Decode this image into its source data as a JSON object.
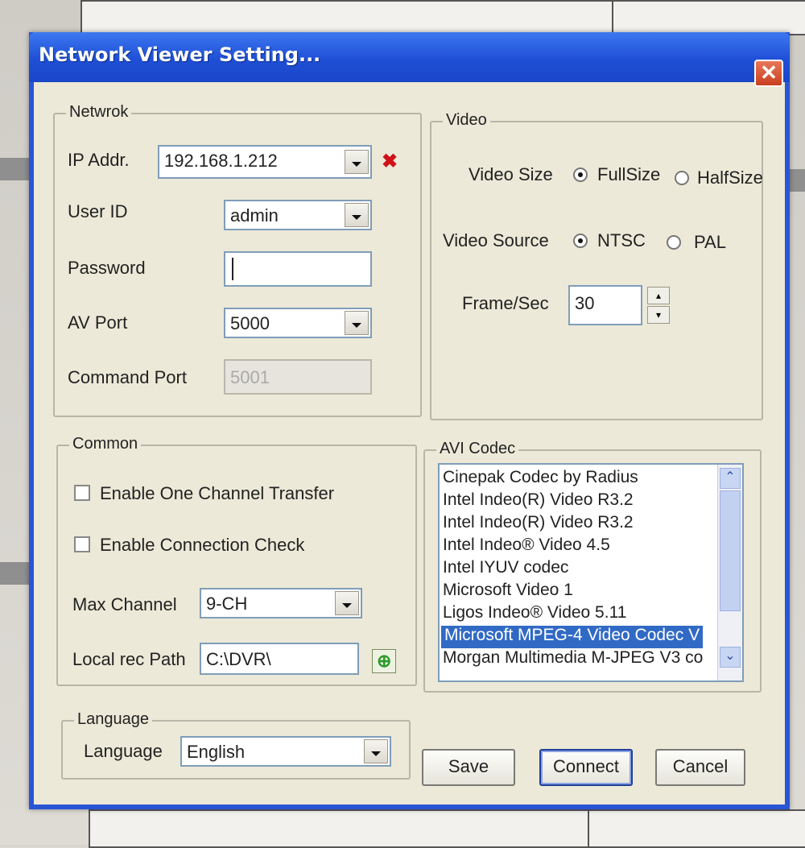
{
  "window": {
    "title": "Network Viewer Setting...",
    "close_glyph": "✕"
  },
  "network": {
    "legend": "Netwrok",
    "ip_label": "IP Addr.",
    "ip_value": "192.168.1.212",
    "clear_icon": "✖",
    "userid_label": "User ID",
    "userid_value": "admin",
    "password_label": "Password",
    "password_value": "",
    "avport_label": "AV Port",
    "avport_value": "5000",
    "cmdport_label": "Command Port",
    "cmdport_value": "5001"
  },
  "video": {
    "legend": "Video",
    "size_label": "Video Size",
    "size_options": [
      "FullSize",
      "HalfSize"
    ],
    "size_selected": "FullSize",
    "source_label": "Video Source",
    "source_options": [
      "NTSC",
      "PAL"
    ],
    "source_selected": "NTSC",
    "fps_label": "Frame/Sec",
    "fps_value": "30"
  },
  "common": {
    "legend": "Common",
    "one_channel_label": "Enable One Channel Transfer",
    "one_channel_checked": false,
    "conn_check_label": "Enable Connection Check",
    "conn_check_checked": false,
    "max_channel_label": "Max Channel",
    "max_channel_value": "9-CH",
    "rec_path_label": "Local rec Path",
    "rec_path_value": "C:\\DVR\\"
  },
  "codec": {
    "legend": "AVI Codec",
    "items": [
      "Cinepak Codec by Radius",
      "Intel Indeo(R) Video R3.2",
      "Intel Indeo(R) Video R3.2",
      "Intel Indeo® Video 4.5",
      "Intel IYUV codec",
      "Microsoft Video 1",
      "Ligos Indeo® Video 5.11",
      "Microsoft MPEG-4 Video Codec V",
      "Morgan Multimedia M-JPEG V3 co"
    ],
    "selected_index": 7
  },
  "language": {
    "legend": "Language",
    "label": "Language",
    "value": "English"
  },
  "buttons": {
    "save": "Save",
    "connect": "Connect",
    "cancel": "Cancel"
  },
  "colors": {
    "titlebar": "#1f4fd6",
    "selection": "#316ac5",
    "close": "#c8401e",
    "clear_icon": "#d0121a"
  }
}
